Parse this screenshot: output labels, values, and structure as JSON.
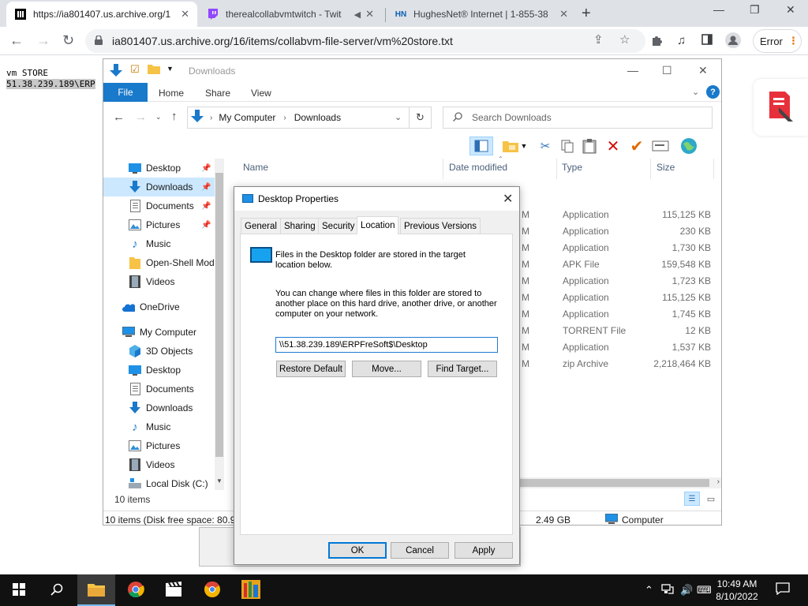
{
  "browser": {
    "tabs": [
      {
        "title": "https://ia801407.us.archive.org/1",
        "favicon": "archive-icon",
        "active": true
      },
      {
        "title": "therealcollabvmtwitch - Twit",
        "favicon": "twitch-icon",
        "active": false
      },
      {
        "title": "HughesNet® Internet | 1-855-38",
        "favicon": "hn-icon",
        "favicon_text": "HN",
        "active": false
      }
    ],
    "url": "ia801407.us.archive.org/16/items/collabvm-file-server/vm%20store.txt",
    "profile_button": "Error",
    "accent": "#1a73e8"
  },
  "page": {
    "line1": "vm STORE",
    "line2": "51.38.239.189\\ERP"
  },
  "explorer": {
    "title": "Downloads",
    "ribbon_tabs": [
      "File",
      "Home",
      "Share",
      "View"
    ],
    "breadcrumb": [
      "My Computer",
      "Downloads"
    ],
    "search_placeholder": "Search Downloads",
    "nav_items": [
      {
        "label": "Desktop",
        "icon": "desktop-icon",
        "pinned": true
      },
      {
        "label": "Downloads",
        "icon": "download-icon",
        "pinned": true,
        "selected": true
      },
      {
        "label": "Documents",
        "icon": "document-icon",
        "pinned": true
      },
      {
        "label": "Pictures",
        "icon": "pictures-icon",
        "pinned": true
      },
      {
        "label": "Music",
        "icon": "music-icon"
      },
      {
        "label": "Open-Shell Mod",
        "icon": "folder-icon"
      },
      {
        "label": "Videos",
        "icon": "videos-icon"
      },
      {
        "label": "OneDrive",
        "icon": "onedrive-icon"
      },
      {
        "label": "My Computer",
        "icon": "computer-icon"
      },
      {
        "label": "3D Objects",
        "icon": "objects-3d-icon"
      },
      {
        "label": "Desktop",
        "icon": "desktop-icon"
      },
      {
        "label": "Documents",
        "icon": "document-icon"
      },
      {
        "label": "Downloads",
        "icon": "download-icon"
      },
      {
        "label": "Music",
        "icon": "music-icon"
      },
      {
        "label": "Pictures",
        "icon": "pictures-icon"
      },
      {
        "label": "Videos",
        "icon": "videos-icon"
      },
      {
        "label": "Local Disk (C:)",
        "icon": "disk-icon"
      }
    ],
    "columns": [
      "Name",
      "Date modified",
      "Type",
      "Size"
    ],
    "files": [
      {
        "date": "M",
        "type": "Application",
        "size": "115,125 KB"
      },
      {
        "date": "M",
        "type": "Application",
        "size": "230 KB"
      },
      {
        "date": "M",
        "type": "Application",
        "size": "1,730 KB"
      },
      {
        "date": "M",
        "type": "APK File",
        "size": "159,548 KB"
      },
      {
        "date": "M",
        "type": "Application",
        "size": "1,723 KB"
      },
      {
        "date": "M",
        "type": "Application",
        "size": "115,125 KB"
      },
      {
        "date": "M",
        "type": "Application",
        "size": "1,745 KB"
      },
      {
        "date": "M",
        "type": "TORRENT File",
        "size": "12 KB"
      },
      {
        "date": "M",
        "type": "Application",
        "size": "1,537 KB"
      },
      {
        "date": "M",
        "type": "zip Archive",
        "size": "2,218,464 KB"
      }
    ],
    "item_count": "10 items",
    "status_left": "10 items (Disk free space: 80.9 G",
    "status_size": "2.49 GB",
    "status_location": "Computer"
  },
  "dialog": {
    "title": "Desktop Properties",
    "tabs": [
      "General",
      "Sharing",
      "Security",
      "Location",
      "Previous Versions"
    ],
    "active_tab": "Location",
    "text1": "Files in the Desktop folder are stored in the target location below.",
    "text2": "You can change where files in this folder are stored to another place on this hard drive, another drive, or another computer on your network.",
    "path": "\\\\51.38.239.189\\ERPFreSoft$\\Desktop",
    "buttons": {
      "restore": "Restore Default",
      "move": "Move...",
      "find": "Find Target..."
    },
    "footer": {
      "ok": "OK",
      "cancel": "Cancel",
      "apply": "Apply"
    }
  },
  "taskbar": {
    "time": "10:49 AM",
    "date": "8/10/2022"
  }
}
